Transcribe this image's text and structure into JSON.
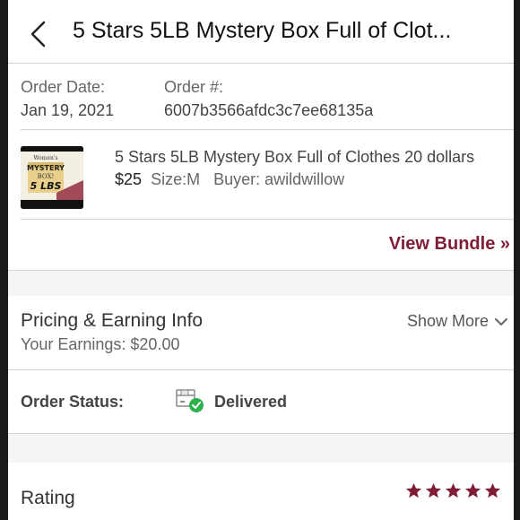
{
  "header": {
    "title": "5 Stars 5LB Mystery Box Full of Clot..."
  },
  "order": {
    "date_label": "Order Date:",
    "date_value": "Jan 19, 2021",
    "number_label": "Order #:",
    "number_value": "6007b3566afdc3c7ee68135a"
  },
  "item": {
    "title": "5 Stars 5LB Mystery Box Full of Clothes 20 dollars",
    "price": "$25",
    "size": "Size:M",
    "buyer": "Buyer: awildwillow",
    "thumb_text": {
      "line1": "Women's",
      "line2": "MYSTERY",
      "line3": "BOX!",
      "line4": "5 LBS"
    }
  },
  "bundle": {
    "link_label": "View Bundle »"
  },
  "pricing": {
    "title": "Pricing & Earning Info",
    "earnings": "Your Earnings: $20.00",
    "show_more_label": "Show More"
  },
  "status": {
    "label": "Order Status:",
    "value": "Delivered",
    "icon": "box-delivered-icon"
  },
  "rating": {
    "label": "Rating",
    "stars": 5
  },
  "colors": {
    "accent": "#7f1d36",
    "delivered_green": "#2bb24c"
  }
}
